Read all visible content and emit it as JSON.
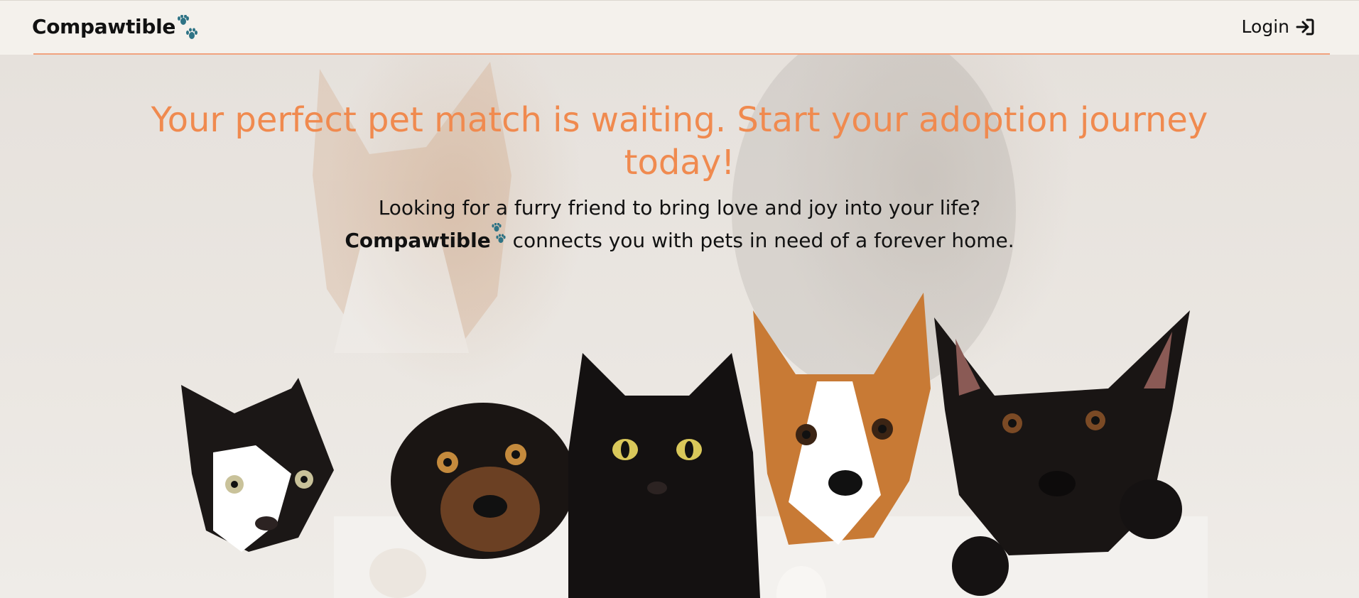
{
  "header": {
    "brand": "Compawtible",
    "login_label": "Login"
  },
  "hero": {
    "headline": "Your perfect pet match is waiting. Start your adoption journey today!",
    "line1": "Looking for a furry friend to bring love and joy into your life?",
    "brand": "Compawtible",
    "line2": "connects you with pets in need of a forever home."
  },
  "colors": {
    "accent": "#f08a4f",
    "paw": "#2e7385",
    "divider": "#f1a27e"
  },
  "icons": [
    "paw-icon",
    "login-arrow-icon"
  ]
}
